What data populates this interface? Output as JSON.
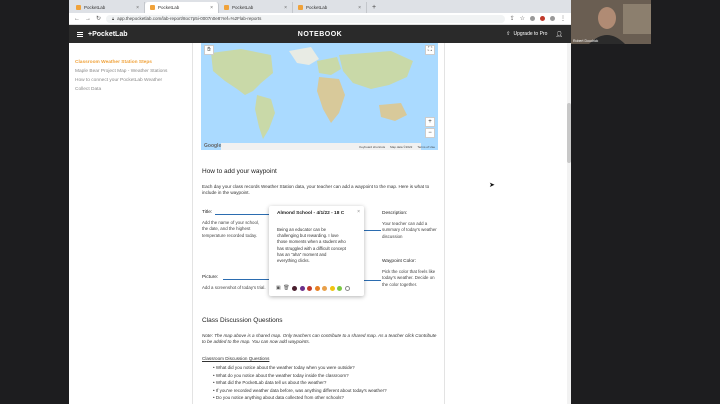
{
  "browser": {
    "tabs": [
      {
        "label": "PocketLab",
        "active": false
      },
      {
        "label": "PocketLab",
        "active": true
      },
      {
        "label": "PocketLab",
        "active": false
      },
      {
        "label": "PocketLab",
        "active": false
      }
    ],
    "url": "app.thepocketlab.com/lab-report/8oc7p5i-0007n0e8?ref=%2Flab-reports"
  },
  "app": {
    "logo": "PocketLab",
    "title": "NOTEBOOK",
    "upgrade_label": "Upgrade to Pro"
  },
  "sidebar": {
    "items": [
      {
        "label": "Classroom Weather Station Steps",
        "active": true
      },
      {
        "label": "Maple Bear Project Map - Weather Stations",
        "active": false
      },
      {
        "label": "How to connect your PocketLab Weather",
        "active": false
      },
      {
        "label": "Collect Data",
        "active": false
      }
    ]
  },
  "map": {
    "keyboard_shortcuts": "Keyboard shortcuts",
    "map_data": "Map data ©2022",
    "terms": "Terms of Use",
    "google": "Google",
    "zoom_in": "+",
    "zoom_out": "−"
  },
  "content": {
    "waypoint_heading": "How to add your waypoint",
    "waypoint_intro": "Each day your class records Weather Station data, your teacher can add a waypoint to the map. Here is what to include in the waypoint.",
    "title_label": "Title:",
    "title_desc": "Add the name of your school, the date, and the highest temperature recorded today.",
    "picture_label": "Picture:",
    "picture_desc": "Add a screenshot of today's trial.",
    "description_label": "Description:",
    "description_desc": "Your teacher can add a summary of today's weather discussion",
    "color_label": "Waypoint Color:",
    "color_desc": "Pick the color that feels like today's weather. Decide on the color together.",
    "card_title": "Almond School - 4/1/22 - 18 C",
    "card_body": "Being an educator can be challenging but rewarding. I love those moments when a student who has struggled with a difficult concept has an \"aha\" moment and everything clicks.",
    "card_close": "×",
    "swatches": [
      "#4a1f2e",
      "#6b2f8a",
      "#c0392b",
      "#e67e22",
      "#e8a04a",
      "#f1c40f",
      "#7ac943"
    ],
    "discussion_heading": "Class Discussion Questions",
    "discussion_note": "Note: The map above is a shared map. Only teachers can contribute to a shared map. As a teacher click Contribute to be added to the map. You can now add waypoints.",
    "questions_heading": "Classroom Discussion Questions",
    "questions": [
      "• What did you notice about the weather today when you were outside?",
      "• What do you notice about the weather today inside the classroom?",
      "• What did the PocketLab data tell us about the weather?",
      "• If you've recorded weather data before, was anything different about today's weather?",
      "• Do you notice anything about data collected from other schools?"
    ]
  },
  "webcam": {
    "name": "Robert Doudrick"
  }
}
